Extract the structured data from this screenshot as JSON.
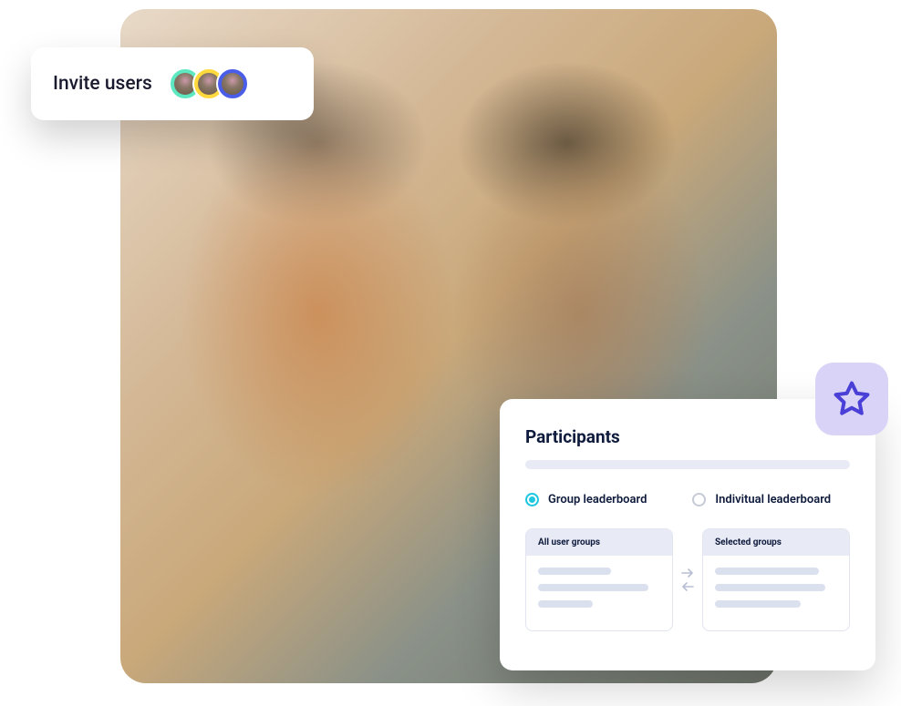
{
  "invite": {
    "label": "Invite users",
    "avatars": [
      {
        "bg": "#5de8c1"
      },
      {
        "bg": "#ffd93d"
      },
      {
        "bg": "#4a5de8"
      }
    ]
  },
  "participants": {
    "title": "Participants",
    "radio_group": {
      "label": "Group leaderboard",
      "selected": true
    },
    "radio_individual": {
      "label": "Indivitual leaderboard",
      "selected": false
    },
    "all_groups_header": "All user groups",
    "selected_groups_header": "Selected groups"
  },
  "colors": {
    "accent_teal": "#1fc8e0",
    "lavender": "#d9d4f7",
    "star_stroke": "#4a3fd6"
  }
}
